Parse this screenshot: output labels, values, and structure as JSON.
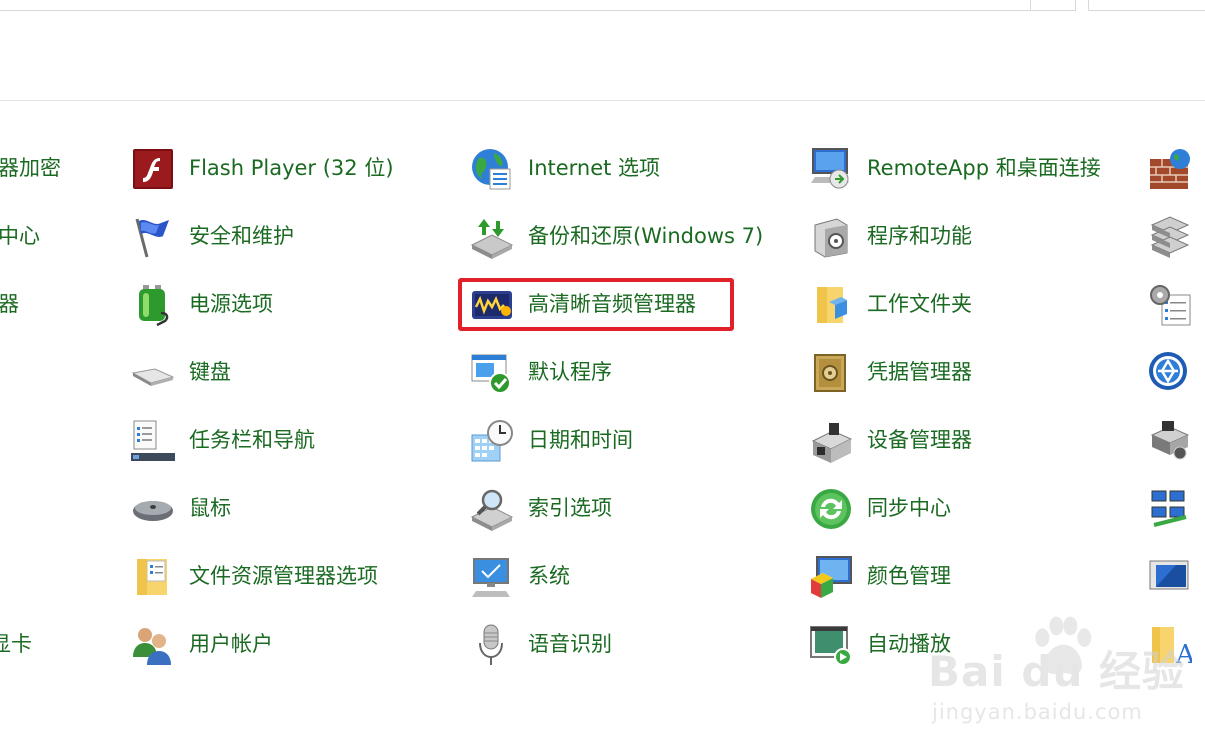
{
  "partial_left": [
    "器加密",
    "中心",
    "器",
    "显卡"
  ],
  "columns": [
    [
      {
        "label": "Flash Player (32 位)",
        "icon": "flash-icon"
      },
      {
        "label": "安全和维护",
        "icon": "flag-icon"
      },
      {
        "label": "电源选项",
        "icon": "battery-icon"
      },
      {
        "label": "键盘",
        "icon": "keyboard-icon"
      },
      {
        "label": "任务栏和导航",
        "icon": "taskbar-icon"
      },
      {
        "label": "鼠标",
        "icon": "mouse-icon"
      },
      {
        "label": "文件资源管理器选项",
        "icon": "folder-options-icon"
      },
      {
        "label": "用户帐户",
        "icon": "users-icon"
      }
    ],
    [
      {
        "label": "Internet 选项",
        "icon": "globe-icon"
      },
      {
        "label": "备份和还原(Windows 7)",
        "icon": "backup-icon"
      },
      {
        "label": "高清晰音频管理器",
        "icon": "audio-manager-icon",
        "highlighted": true
      },
      {
        "label": "默认程序",
        "icon": "default-programs-icon"
      },
      {
        "label": "日期和时间",
        "icon": "clock-icon"
      },
      {
        "label": "索引选项",
        "icon": "index-icon"
      },
      {
        "label": "系统",
        "icon": "monitor-icon"
      },
      {
        "label": "语音识别",
        "icon": "microphone-icon"
      }
    ],
    [
      {
        "label": "RemoteApp 和桌面连接",
        "icon": "remote-desktop-icon"
      },
      {
        "label": "程序和功能",
        "icon": "programs-icon"
      },
      {
        "label": "工作文件夹",
        "icon": "work-folders-icon"
      },
      {
        "label": "凭据管理器",
        "icon": "safe-icon"
      },
      {
        "label": "设备管理器",
        "icon": "device-manager-icon"
      },
      {
        "label": "同步中心",
        "icon": "sync-icon"
      },
      {
        "label": "颜色管理",
        "icon": "color-icon"
      },
      {
        "label": "自动播放",
        "icon": "autoplay-icon"
      }
    ]
  ],
  "partial_right_icons": [
    "firewall-icon",
    "storage-icon",
    "admin-tools-icon",
    "ease-of-access-icon",
    "devices-printers-icon",
    "network-icon",
    "remote-monitor-icon",
    "fonts-icon"
  ],
  "watermark": {
    "brand": "Bai du 经验",
    "url": "jingyan.baidu.com"
  },
  "colors": {
    "link": "#1a6a21",
    "highlight": "#e2202a"
  }
}
